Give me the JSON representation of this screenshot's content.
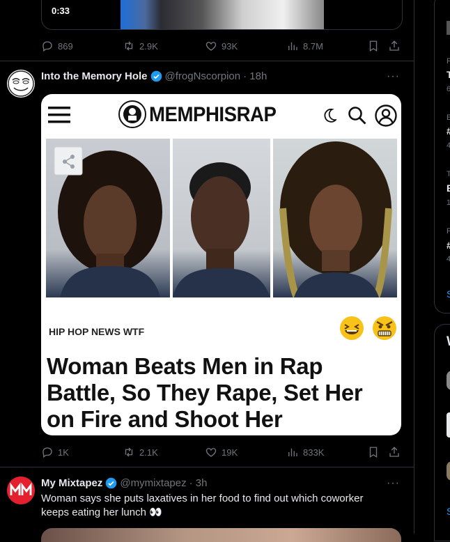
{
  "top_tweet": {
    "video_time": "0:33",
    "actions": {
      "replies": "869",
      "retweets": "2.9K",
      "likes": "93K",
      "views": "8.7M"
    }
  },
  "tweet1": {
    "name": "Into the Memory Hole",
    "handle": "@frogNscorpion",
    "time": "· 18h",
    "more": "···",
    "card": {
      "site_name": "MEMPHISRAP",
      "category": "HIP HOP NEWS  WTF",
      "headline": "Woman Beats Men in Rap Battle, So They Rape, Set Her on Fire and Shoot Her"
    },
    "actions": {
      "replies": "1K",
      "retweets": "2.1K",
      "likes": "19K",
      "views": "833K"
    }
  },
  "tweet2": {
    "name": "My Mixtapez",
    "handle": "@mymixtapez",
    "time": "· 3h",
    "more": "···",
    "text": "Woman says she puts laxatives in her food to find out which coworker keeps eating her lunch 👀"
  },
  "right_column": {
    "letters": [
      "F",
      "T",
      "6",
      "E",
      "#",
      "4",
      "T",
      "E",
      "1",
      "F",
      "#",
      "4",
      "S",
      "W",
      "S"
    ]
  },
  "colors": {
    "accent": "#1d9bf0",
    "muted": "#71767b",
    "text": "#e7e9ea",
    "border": "#2f3336"
  }
}
